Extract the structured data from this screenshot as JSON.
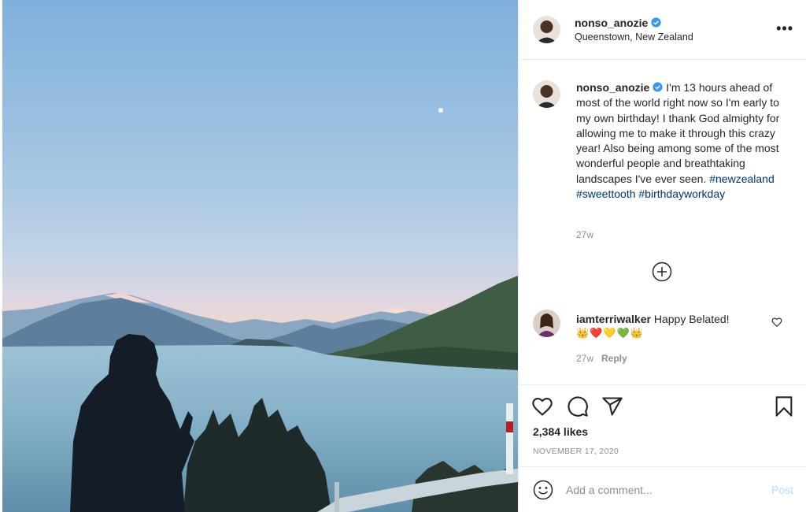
{
  "post": {
    "username": "nonso_anozie",
    "location": "Queenstown, New Zealand",
    "more_label": "•••",
    "caption": {
      "text": "I'm 13 hours ahead of most of the world right now so I'm early to my own birthday! I thank God almighty for allowing me to make it through this crazy year! Also being among some of the most wonderful people and breathtaking landscapes I've ever seen.",
      "hashtags": [
        "#newzealand",
        "#sweettooth",
        "#birthdayworkday"
      ],
      "time": "27w"
    },
    "comment": {
      "username": "iamterriwalker",
      "text": "Happy Belated!",
      "emojis": "👑❤️💛💚👑",
      "time": "27w",
      "reply_label": "Reply"
    },
    "likes": "2,384 likes",
    "date": "NOVEMBER 17, 2020",
    "add_comment": {
      "placeholder": "Add a comment...",
      "post_label": "Post"
    }
  },
  "icons": {
    "verified": "verified-badge-icon",
    "more": "more-options-icon",
    "load_more": "plus-circle-icon",
    "comment_like": "heart-icon",
    "like": "heart-icon",
    "comment": "comment-bubble-icon",
    "share": "paper-plane-icon",
    "save": "bookmark-icon",
    "emoji": "smiley-icon"
  },
  "colors": {
    "verified": "#3897f0",
    "hashtag": "#00376b",
    "muted": "#8e8e8e",
    "post_disabled": "#b2dffc"
  }
}
